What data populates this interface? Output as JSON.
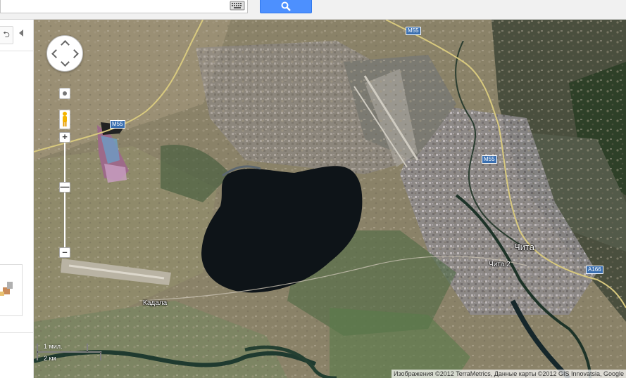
{
  "search": {
    "value": ""
  },
  "map": {
    "road_labels": [
      "M55",
      "M55",
      "M55",
      "A166"
    ],
    "place_labels": [
      "Чита",
      "Чита 2",
      "Кадала"
    ],
    "scale": {
      "miles_label": "1 мил.",
      "km_label": "2 км"
    },
    "attribution": "Изображения ©2012 TerraMetrics, Данные карты ©2012 GIS Innovatsia, Google"
  },
  "colors": {
    "accent": "#4d90fe",
    "road_shield": "#3a6fb0"
  },
  "icons": [
    "keyboard-icon",
    "search-icon",
    "link-icon",
    "collapse-arrow-icon",
    "pan-control-icon",
    "pegman-icon"
  ]
}
